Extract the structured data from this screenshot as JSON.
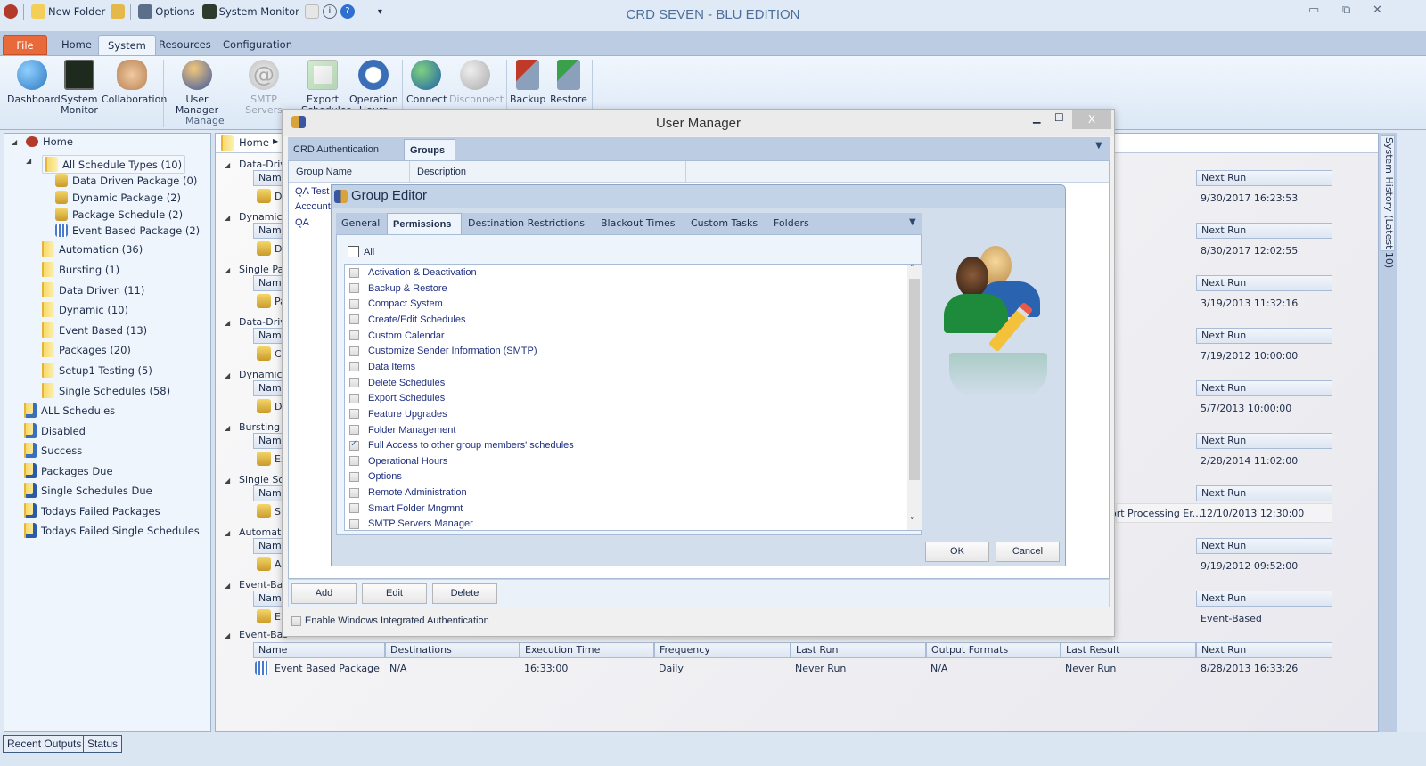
{
  "app": {
    "title": "CRD SEVEN - BLU EDITION",
    "quick_access": [
      {
        "label": "",
        "icon": "app-logo-icon"
      },
      {
        "label": "New Folder",
        "icon": "new-folder-icon"
      },
      {
        "label": "",
        "icon": "move-folder-icon"
      },
      {
        "label": "Options",
        "icon": "options-icon"
      },
      {
        "label": "System Monitor",
        "icon": "system-monitor-icon"
      },
      {
        "label": "",
        "icon": "clipboard-icon"
      },
      {
        "label": "",
        "icon": "info-icon"
      },
      {
        "label": "",
        "icon": "help-icon"
      }
    ],
    "quick_access_more": "▾",
    "window_controls": {
      "minimize": "▭",
      "restore": "⧉",
      "close": "✕"
    }
  },
  "ribbon": {
    "tabs": [
      "File",
      "Home",
      "System",
      "Resources",
      "Configuration"
    ],
    "active_tab": "System",
    "buttons": [
      {
        "label": "Dashboard",
        "enabled": true,
        "color": "#3a8fd8"
      },
      {
        "label": "System Monitor",
        "enabled": true,
        "color": "#2d3b2d"
      },
      {
        "label": "Collaboration",
        "enabled": true,
        "color": "#c98a5b"
      },
      {
        "label": "User Manager",
        "enabled": true,
        "color": "#d9a23b"
      },
      {
        "label": "SMTP Servers",
        "enabled": false,
        "color": "#c8c8c8"
      },
      {
        "label": "Export Schedules",
        "enabled": true,
        "color": "#4cb84c"
      },
      {
        "label": "Operation Hours",
        "enabled": true,
        "color": "#3a6fb8"
      },
      {
        "label": "Connect",
        "enabled": true,
        "color": "#2f8a3f"
      },
      {
        "label": "Disconnect",
        "enabled": false,
        "color": "#bdbdbd"
      },
      {
        "label": "Backup",
        "enabled": true,
        "color": "#c03a2a"
      },
      {
        "label": "Restore",
        "enabled": true,
        "color": "#3aa04a"
      }
    ],
    "group_label": "Manage"
  },
  "tree": {
    "root": "Home",
    "items": [
      {
        "label": "All Schedule Types (10)",
        "level": 1,
        "icon": "folder-icon",
        "selected": true
      },
      {
        "label": "Data Driven Package (0)",
        "level": 2,
        "icon": "data-driven-package-icon"
      },
      {
        "label": "Dynamic Package (2)",
        "level": 2,
        "icon": "dynamic-package-icon"
      },
      {
        "label": "Package Schedule (2)",
        "level": 2,
        "icon": "package-icon"
      },
      {
        "label": "Event Based Package (2)",
        "level": 2,
        "icon": "event-package-icon"
      },
      {
        "label": "Automation (36)",
        "level": 1,
        "icon": "folder-icon"
      },
      {
        "label": "Bursting (1)",
        "level": 1,
        "icon": "folder-icon"
      },
      {
        "label": "Data Driven (11)",
        "level": 1,
        "icon": "folder-icon"
      },
      {
        "label": "Dynamic  (10)",
        "level": 1,
        "icon": "folder-icon"
      },
      {
        "label": "Event Based (13)",
        "level": 1,
        "icon": "folder-icon"
      },
      {
        "label": "Packages (20)",
        "level": 1,
        "icon": "folder-icon"
      },
      {
        "label": "Setup1 Testing (5)",
        "level": 1,
        "icon": "folder-icon"
      },
      {
        "label": "Single Schedules (58)",
        "level": 1,
        "icon": "folder-icon"
      },
      {
        "label": "ALL Schedules",
        "level": 0,
        "icon": "smart-folder-icon"
      },
      {
        "label": "Disabled",
        "level": 0,
        "icon": "smart-folder-icon"
      },
      {
        "label": "Success",
        "level": 0,
        "icon": "smart-folder-icon"
      },
      {
        "label": "Packages Due",
        "level": 0,
        "icon": "smart-folder-info-icon"
      },
      {
        "label": "Single Schedules Due",
        "level": 0,
        "icon": "smart-folder-info-icon"
      },
      {
        "label": "Todays Failed Packages",
        "level": 0,
        "icon": "smart-folder-info-icon"
      },
      {
        "label": "Todays Failed Single Schedules",
        "level": 0,
        "icon": "smart-folder-info-icon"
      }
    ]
  },
  "main": {
    "breadcrumb": [
      "Home"
    ],
    "sections": [
      {
        "title": "Data-Driv",
        "row_name": "D",
        "next_run": "9/30/2017 16:23:53",
        "last_result": ""
      },
      {
        "title": "Dynamic P",
        "row_name": "D",
        "next_run": "8/30/2017 12:02:55",
        "last_result": ""
      },
      {
        "title": "Single Pac",
        "row_name": "Pa",
        "next_run": "3/19/2013 11:32:16",
        "last_result": ""
      },
      {
        "title": "Data-Driv",
        "row_name": "C",
        "next_run": "7/19/2012 10:00:00",
        "last_result": ""
      },
      {
        "title": "Dynamic S",
        "row_name": "D",
        "next_run": "5/7/2013 10:00:00",
        "last_result": ""
      },
      {
        "title": "Bursting S",
        "row_name": "Ex",
        "next_run": "2/28/2014 11:02:00",
        "last_result": ""
      },
      {
        "title": "Single Sch",
        "row_name": "Si",
        "next_run": "12/10/2013 12:30:00",
        "last_result": "ort Processing Er..."
      },
      {
        "title": "Automati",
        "row_name": "A",
        "next_run": "9/19/2012 09:52:00",
        "last_result": ""
      },
      {
        "title": "Event-Bas",
        "row_name": "E",
        "next_run": "Event-Based",
        "last_result": ""
      }
    ],
    "last_section": {
      "title": "Event-Bas",
      "columns": [
        "Name",
        "Destinations",
        "Execution Time",
        "Frequency",
        "Last Run",
        "Output Formats",
        "Last Result",
        "Next Run"
      ],
      "row": [
        "Event Based Package",
        "N/A",
        "16:33:00",
        "Daily",
        "Never Run",
        "N/A",
        "Never Run",
        "8/28/2013 16:33:26"
      ]
    },
    "col_name": "Name",
    "col_next_run": "Next Run"
  },
  "side_panel": {
    "label": "System  History (Latest 10)"
  },
  "status_tabs": [
    "Recent Outputs",
    "Status"
  ],
  "user_manager": {
    "title": "User Manager",
    "tabs": [
      "CRD Authentication",
      "Groups"
    ],
    "active_tab": "Groups",
    "columns": [
      "Group Name",
      "Description"
    ],
    "groups": [
      "QA Test",
      "Accounts",
      "QA"
    ],
    "buttons": {
      "add": "Add",
      "edit": "Edit",
      "delete": "Delete"
    },
    "windows_auth": {
      "label": "Enable Windows Integrated Authentication",
      "checked": false
    },
    "controls": {
      "minimize": "▁",
      "maximize": "☐",
      "close": "X"
    }
  },
  "group_editor": {
    "title": "Group Editor",
    "tabs": [
      "General",
      "Permissions",
      "Destination Restrictions",
      "Blackout Times",
      "Custom Tasks",
      "Folders"
    ],
    "active_tab": "Permissions",
    "all_label": "All",
    "all_checked": false,
    "permissions": [
      {
        "label": "Activation & Deactivation",
        "checked": false
      },
      {
        "label": "Backup & Restore",
        "checked": false
      },
      {
        "label": "Compact System",
        "checked": false
      },
      {
        "label": "Create/Edit Schedules",
        "checked": false
      },
      {
        "label": "Custom Calendar",
        "checked": false
      },
      {
        "label": "Customize Sender Information (SMTP)",
        "checked": false
      },
      {
        "label": "Data Items",
        "checked": false
      },
      {
        "label": "Delete Schedules",
        "checked": false
      },
      {
        "label": "Export Schedules",
        "checked": false
      },
      {
        "label": "Feature Upgrades",
        "checked": false
      },
      {
        "label": "Folder Management",
        "checked": false
      },
      {
        "label": "Full Access to other group members' schedules",
        "checked": true
      },
      {
        "label": "Operational Hours",
        "checked": false
      },
      {
        "label": "Options",
        "checked": false
      },
      {
        "label": "Remote Administration",
        "checked": false
      },
      {
        "label": "Smart Folder Mngmnt",
        "checked": false
      },
      {
        "label": "SMTP Servers Manager",
        "checked": false
      }
    ],
    "ok_label": "OK",
    "cancel_label": "Cancel"
  }
}
